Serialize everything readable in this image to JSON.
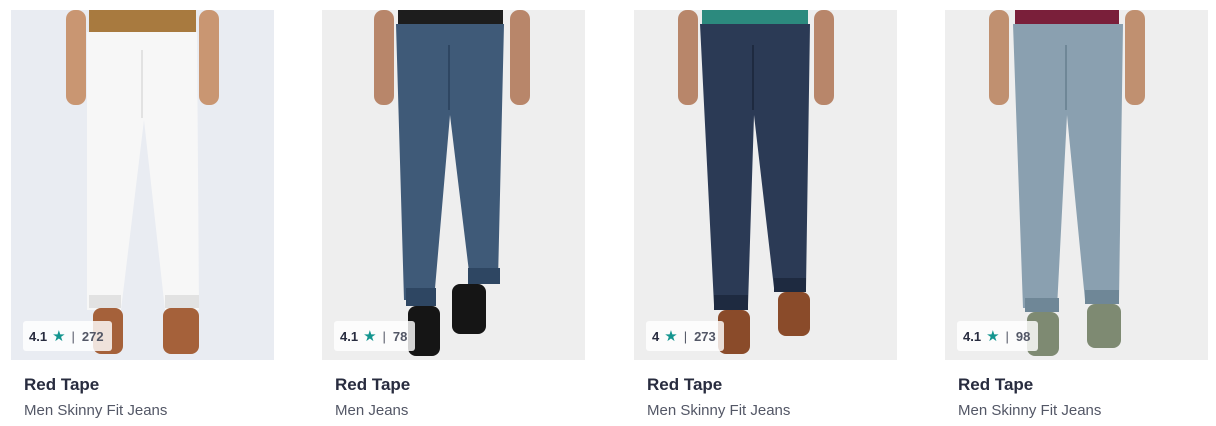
{
  "products": [
    {
      "brand": "Red Tape",
      "name": "Men Skinny Fit Jeans",
      "rating": "4.1",
      "count": "272",
      "colors": {
        "bg": "#e9ecf2",
        "shirt": "#a87a3f",
        "denim": "#f7f7f7",
        "denim_shade": "#e2e2e2",
        "shoe": "#a5613a",
        "skin": "#c99672"
      }
    },
    {
      "brand": "Red Tape",
      "name": "Men Jeans",
      "rating": "4.1",
      "count": "78",
      "colors": {
        "bg": "#eeeeee",
        "shirt": "#1d1d1d",
        "denim": "#3f5a78",
        "denim_shade": "#2e4662",
        "shoe": "#151515",
        "skin": "#b8866a"
      }
    },
    {
      "brand": "Red Tape",
      "name": "Men Skinny Fit Jeans",
      "rating": "4",
      "count": "273",
      "colors": {
        "bg": "#eeeeee",
        "shirt": "#2c8a7e",
        "denim": "#2b3a55",
        "denim_shade": "#1e2a40",
        "shoe": "#8a4b2a",
        "skin": "#b8866a"
      }
    },
    {
      "brand": "Red Tape",
      "name": "Men Skinny Fit Jeans",
      "rating": "4.1",
      "count": "98",
      "colors": {
        "bg": "#eeeeee",
        "shirt": "#7a1f3a",
        "denim": "#8aa0b0",
        "denim_shade": "#6f8797",
        "shoe": "#7e8a72",
        "skin": "#c09070"
      }
    }
  ]
}
